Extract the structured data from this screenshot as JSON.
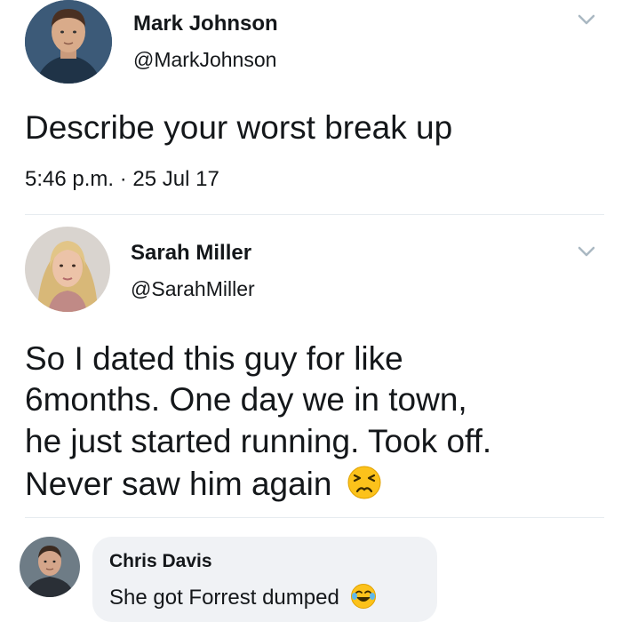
{
  "tweet1": {
    "author_name": "Mark Johnson",
    "author_handle": "@MarkJohnson",
    "text": "Describe your worst break up",
    "timestamp": "5:46 p.m. · 25 Jul 17",
    "menu_icon": "chevron-down-icon"
  },
  "tweet2": {
    "author_name": "Sarah Miller",
    "author_handle": "@SarahMiller",
    "lines": [
      "So I dated this guy for like",
      "6months. One day we in town,",
      "he just started running. Took off.",
      "Never saw him again"
    ],
    "emoji": "persevering-face-emoji",
    "menu_icon": "chevron-down-icon"
  },
  "comment": {
    "author_name": "Chris Davis",
    "text": "She got Forrest dumped",
    "emoji": "tears-of-joy-emoji"
  },
  "colors": {
    "text": "#14171a",
    "divider": "#e6ecf0",
    "bubble": "#f0f2f5",
    "chevron": "#aab8c2"
  }
}
